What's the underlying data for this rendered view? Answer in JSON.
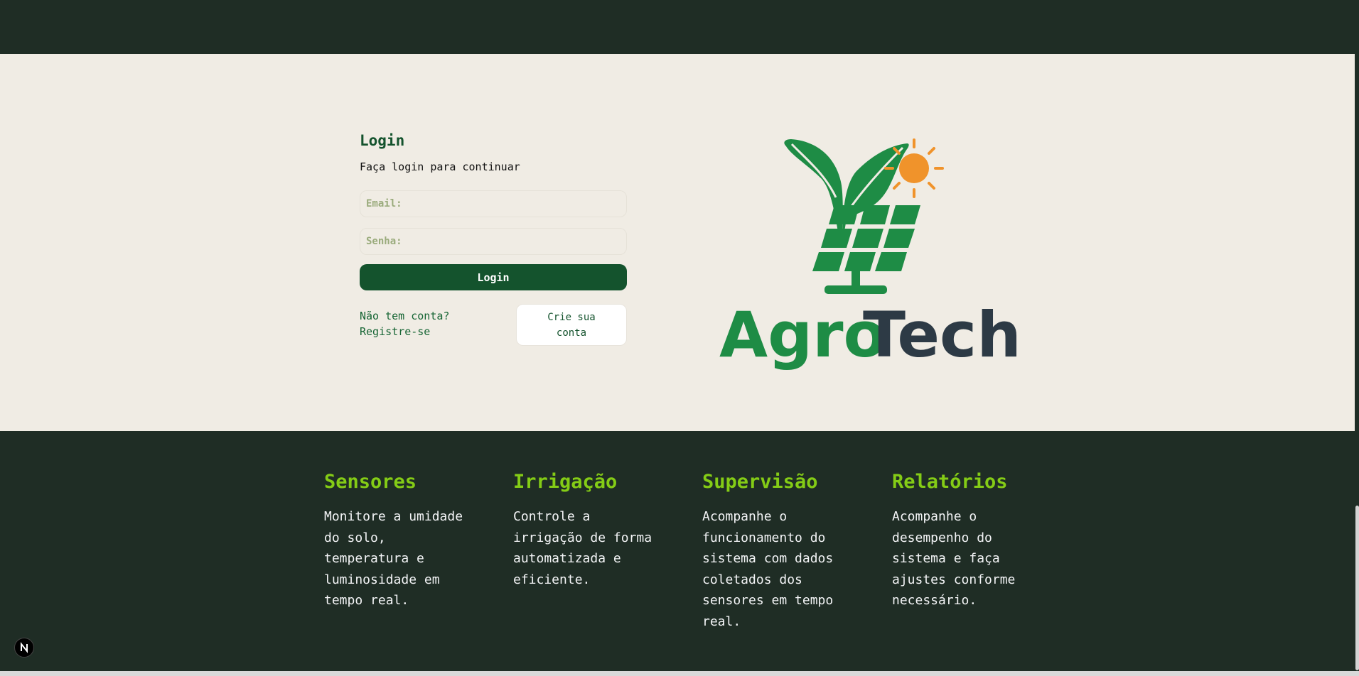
{
  "login": {
    "title": "Login",
    "subtitle": "Faça login para continuar",
    "email_placeholder": "Email:",
    "password_placeholder": "Senha:",
    "submit_label": "Login",
    "register_text": "Não tem conta? Registre-se",
    "create_account_label": "Crie sua conta"
  },
  "logo": {
    "part_agro": "Agro",
    "part_tech": "Tech",
    "icon": "leaf-sun-solar-panel"
  },
  "features": [
    {
      "title": "Sensores",
      "text": "Monitore a umidade do solo, temperatura e luminosidade em tempo real."
    },
    {
      "title": "Irrigação",
      "text": "Controle a irrigação de forma automatizada e eficiente."
    },
    {
      "title": "Supervisão",
      "text": "Acompanhe o funcionamento do sistema com dados coletados dos sensores em tempo real."
    },
    {
      "title": "Relatórios",
      "text": "Acompanhe o desempenho do sistema e faça ajustes conforme necessário."
    }
  ],
  "colors": {
    "dark_bg": "#1f2d25",
    "cream_bg": "#f0ece4",
    "primary_green": "#14532d",
    "accent_lime": "#84cc16",
    "logo_green": "#1e8c45",
    "logo_dark": "#2d3a45",
    "sun_orange": "#f0932b"
  },
  "badge": {
    "letter": "N",
    "icon": "nextjs-icon"
  }
}
